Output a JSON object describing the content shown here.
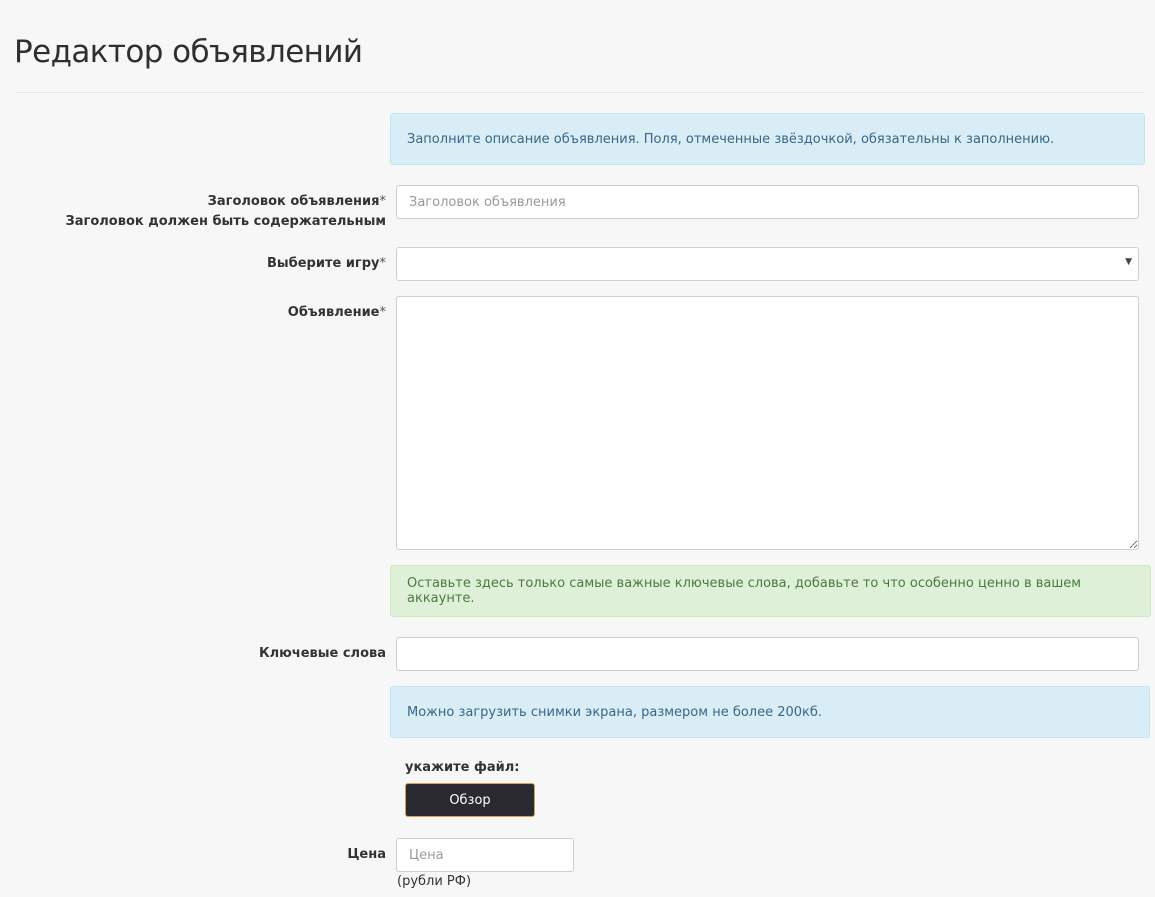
{
  "page": {
    "title": "Редактор объявлений"
  },
  "alerts": {
    "intro": "Заполните описание объявления. Поля, отмеченные звёздочкой, обязательны к заполнению.",
    "keywords_hint": "Оставьте здесь только самые важные ключевые слова, добавьте то что особенно ценно в вашем аккаунте.",
    "upload_hint": "Можно загрузить снимки экрана, размером не более 200кб."
  },
  "form": {
    "title_label": "Заголовок объявления",
    "title_required": "*",
    "title_sublabel": "Заголовок должен быть содержательным",
    "title_placeholder": "Заголовок объявления",
    "title_value": "",
    "game_label": "Выберите игру",
    "game_required": "*",
    "game_selected": "",
    "ad_label": "Объявление",
    "ad_required": "*",
    "ad_value": "",
    "keywords_label": "Ключевые слова",
    "keywords_value": "",
    "file_label": "укажите файл:",
    "browse_label": "Обзор",
    "price_label": "Цена",
    "price_placeholder": "Цена",
    "price_value": "",
    "price_help": "(рубли РФ)"
  },
  "icons": {
    "select_arrow": "caret-down-icon"
  }
}
